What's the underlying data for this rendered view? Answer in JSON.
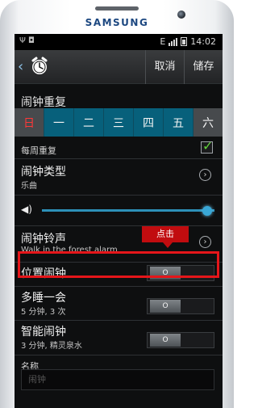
{
  "device": {
    "brand": "SAMSUNG"
  },
  "status_bar": {
    "time": "14:02",
    "left_icons": "Ψ ◘",
    "network": "E"
  },
  "action_bar": {
    "cancel_label": "取消",
    "save_label": "储存"
  },
  "repeat": {
    "title": "闹钟重复",
    "days": [
      "日",
      "一",
      "二",
      "三",
      "四",
      "五",
      "六"
    ],
    "weekly_label": "每周重复",
    "weekly_checked": true
  },
  "alarm_type": {
    "title": "闹钟类型",
    "value": "乐曲"
  },
  "volume": {
    "level": 0.96
  },
  "ringtone": {
    "title": "闹钟铃声",
    "value": "Walk in the forest alarm"
  },
  "location_alarm": {
    "title": "位置闹钟",
    "toggle_symbol": "O",
    "state": "off"
  },
  "snooze": {
    "title": "多睡一会",
    "value": "5 分钟, 3 次",
    "toggle_symbol": "O"
  },
  "smart_alarm": {
    "title": "智能闹钟",
    "value": "3 分钟, 精灵泉水",
    "toggle_symbol": "O"
  },
  "name": {
    "label": "名称",
    "placeholder": "闹钟"
  },
  "annotation": {
    "callout": "点击"
  },
  "colors": {
    "accent": "#07607b",
    "highlight": "#e5161a",
    "callout": "#c10c0f",
    "check": "#63d13d"
  }
}
